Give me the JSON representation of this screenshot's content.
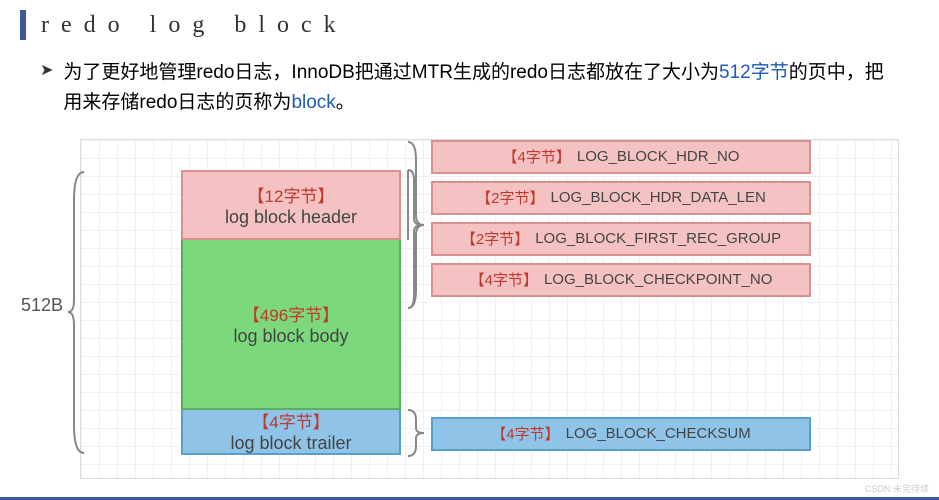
{
  "title": "redo log block",
  "bullet": {
    "arrow": "➤",
    "text_1": "为了更好地管理redo日志，InnoDB把通过MTR生成的redo日志都放在了大小为",
    "highlight_1": "512字节",
    "text_2": "的页中，把用来存储redo日志的页称为",
    "highlight_2": "block",
    "text_3": "。"
  },
  "diagram": {
    "total_size": "512B",
    "blocks": {
      "header": {
        "size": "【12字节】",
        "label": "log block header"
      },
      "body": {
        "size": "【496字节】",
        "label": "log block body"
      },
      "trailer": {
        "size": "【4字节】",
        "label": "log block trailer"
      }
    },
    "header_details": [
      {
        "size": "【4字节】",
        "name": "LOG_BLOCK_HDR_NO"
      },
      {
        "size": "【2字节】",
        "name": "LOG_BLOCK_HDR_DATA_LEN"
      },
      {
        "size": "【2字节】",
        "name": "LOG_BLOCK_FIRST_REC_GROUP"
      },
      {
        "size": "【4字节】",
        "name": "LOG_BLOCK_CHECKPOINT_NO"
      }
    ],
    "trailer_details": [
      {
        "size": "【4字节】",
        "name": "LOG_BLOCK_CHECKSUM"
      }
    ]
  },
  "watermark": "CSDN 未完待续"
}
